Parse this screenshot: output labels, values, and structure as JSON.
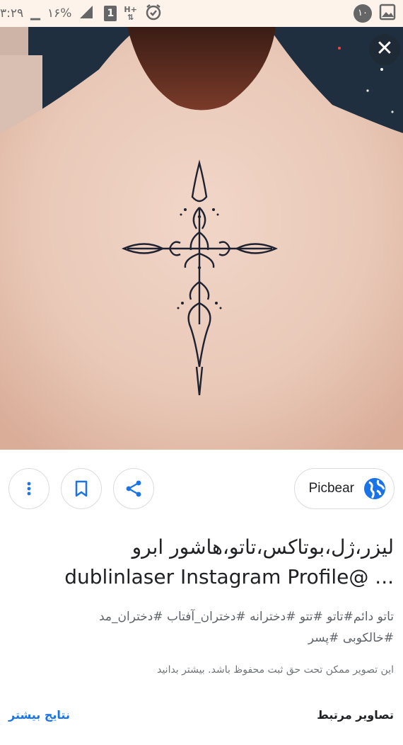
{
  "status_bar": {
    "time": "۳:۲۹",
    "battery_percent": "۱۶%",
    "sim_slot": "1",
    "network_type": "H+",
    "notification_count": "۱۰",
    "icons": [
      "battery-icon",
      "signal-icon",
      "sim-icon",
      "network-icon",
      "alarm-icon",
      "notification-badge",
      "gallery-icon"
    ]
  },
  "viewer": {
    "image_subject": "cross tattoo on upper back",
    "close_icon": "close-icon"
  },
  "actions": {
    "icons": [
      "more-vert-icon",
      "bookmark-icon",
      "share-icon"
    ],
    "source_name": "Picbear",
    "source_icon": "globe-icon"
  },
  "result": {
    "title_line1": "لیزر،ژل،بوتاکس،تاتو،هاشور ابرو",
    "title_line2": "dublinlaser Instagram Profile@ ...",
    "tags_line1": "تاتو دائم#تاتو #تتو #دخترانه #دختران_آفتاب #دختران_مد",
    "tags_line2": "#خالکوبی #پسر",
    "copyright": "این تصویر ممکن تحت حق ثبت محفوظ باشد. بیشتر بدانید"
  },
  "footer": {
    "related_label": "تصاویر مرتبط",
    "more_results": "نتایج بیشتر"
  },
  "colors": {
    "status_bar_bg": "#fdf3ea",
    "link": "#1a73e8",
    "text": "#202124",
    "secondary_text": "#5f6368",
    "border": "#dadce0"
  }
}
